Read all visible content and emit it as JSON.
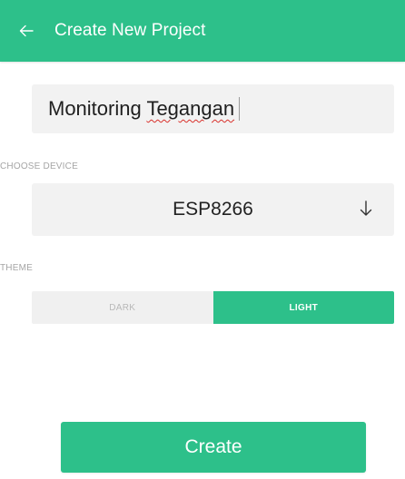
{
  "header": {
    "title": "Create New Project",
    "back_icon": "arrow-left-icon"
  },
  "project_name": {
    "value": "Monitoring Tegangan",
    "value_first": "Monitoring",
    "value_second": "Tegangan"
  },
  "device": {
    "section_label": "CHOOSE DEVICE",
    "selected": "ESP8266",
    "dropdown_icon": "arrow-down-icon"
  },
  "theme": {
    "section_label": "THEME",
    "options": [
      "DARK",
      "LIGHT"
    ],
    "selected": "LIGHT"
  },
  "create_button": {
    "label": "Create"
  },
  "colors": {
    "accent": "#2dc08a",
    "field_bg": "#f2f2f2",
    "label_gray": "#a5a5a5",
    "spellcheck_underline": "#d9302b"
  }
}
